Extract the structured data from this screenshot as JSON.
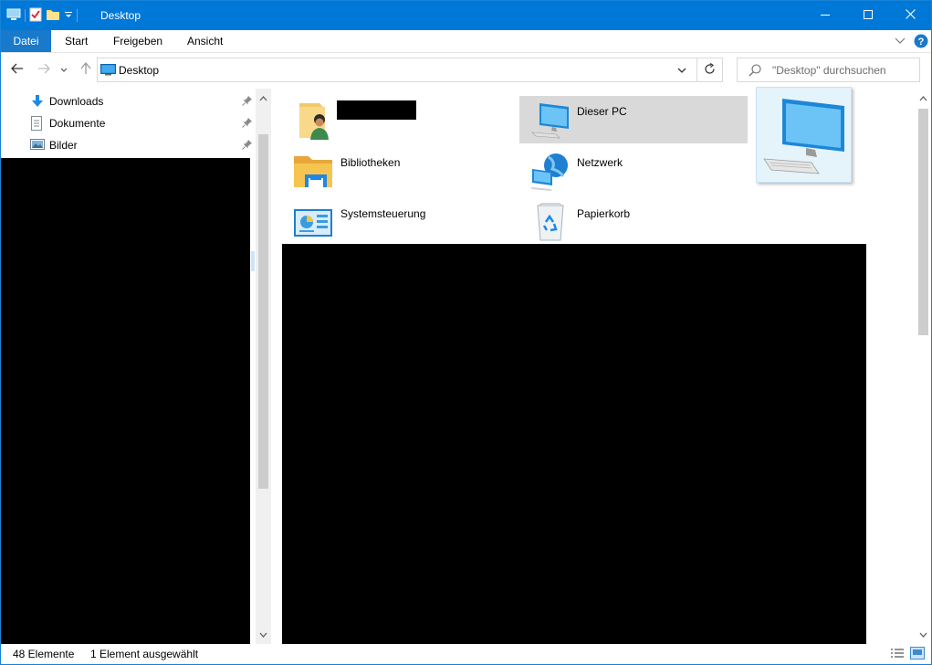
{
  "window": {
    "title": "Desktop",
    "accent_color": "#0078d7",
    "controls": [
      "minimize-icon",
      "maximize-icon",
      "close-icon"
    ]
  },
  "quick_access_toolbar": {
    "icons": [
      "explorer-icon",
      "properties-icon",
      "new-folder-icon",
      "customize-dropdown-icon"
    ]
  },
  "ribbon": {
    "tabs": [
      {
        "label": "Datei",
        "active": true
      },
      {
        "label": "Start"
      },
      {
        "label": "Freigeben"
      },
      {
        "label": "Ansicht"
      }
    ],
    "help_icon": "help-icon",
    "expand_icon": "chevron-down-icon"
  },
  "navigation": {
    "back_icon": "arrow-left-icon",
    "forward_icon": "arrow-right-icon",
    "recent_icon": "chevron-down-icon",
    "up_icon": "arrow-up-icon"
  },
  "address_bar": {
    "location": "Desktop",
    "icons": [
      "desktop-icon",
      "chevron-down-icon",
      "refresh-icon"
    ]
  },
  "search": {
    "placeholder": "\"Desktop\" durchsuchen",
    "icon": "search-icon"
  },
  "nav_pane": {
    "items": [
      {
        "label": "Downloads",
        "icon": "downloads-icon",
        "pinned": true
      },
      {
        "label": "Dokumente",
        "icon": "documents-icon",
        "pinned": true
      },
      {
        "label": "Bilder",
        "icon": "pictures-icon",
        "pinned": true
      }
    ]
  },
  "content": {
    "items": [
      {
        "label": "",
        "icon": "user-folder-icon",
        "redacted": true
      },
      {
        "label": "Dieser PC",
        "icon": "computer-icon",
        "selected": true
      },
      {
        "label": "Bibliotheken",
        "icon": "libraries-icon"
      },
      {
        "label": "Netzwerk",
        "icon": "network-icon"
      },
      {
        "label": "Systemsteuerung",
        "icon": "control-panel-icon"
      },
      {
        "label": "Papierkorb",
        "icon": "recycle-bin-icon"
      }
    ],
    "drag_preview_icon": "computer-icon"
  },
  "status_bar": {
    "item_count": "48 Elemente",
    "selection": "1 Element ausgewählt",
    "view_icons": [
      "details-view-icon",
      "large-icons-view-icon"
    ]
  }
}
